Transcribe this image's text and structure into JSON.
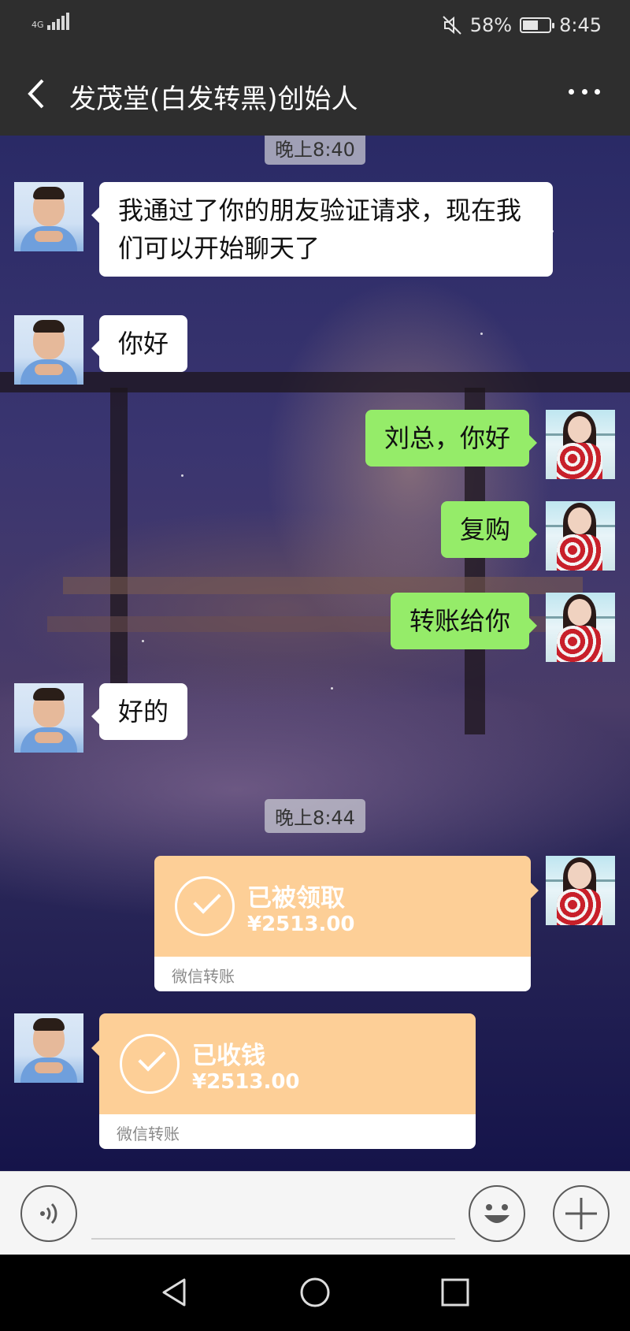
{
  "status_bar": {
    "network": "4G",
    "battery_percent": "58%",
    "battery_level": 0.58,
    "time": "8:45",
    "mute_icon": "mute-icon",
    "battery_icon": "battery-icon",
    "signal_icon": "signal-icon"
  },
  "header": {
    "title": "发茂堂(白发转黑)创始人",
    "back_icon": "chevron-left-icon",
    "more_icon": "more-horizontal-icon"
  },
  "messages": {
    "ts1": "晚上8:40",
    "m1": "我通过了你的朋友验证请求，现在我们可以开始聊天了",
    "m2": "你好",
    "m3": "刘总，你好",
    "m4": "复购",
    "m5": "转账给你",
    "m6": "好的",
    "ts2": "晚上8:44",
    "tr1": {
      "status": "已被领取",
      "amount": "¥2513.00",
      "label": "微信转账"
    },
    "tr2": {
      "status": "已收钱",
      "amount": "¥2513.00",
      "label": "微信转账"
    }
  },
  "input_bar": {
    "voice_icon": "voice-icon",
    "emoji_icon": "emoji-icon",
    "plus_icon": "plus-icon",
    "placeholder": ""
  },
  "nav_bar": {
    "back_icon": "triangle-back-icon",
    "home_icon": "circle-home-icon",
    "recents_icon": "square-recents-icon"
  },
  "colors": {
    "header_bg": "#2e2e2e",
    "incoming_bubble": "#ffffff",
    "outgoing_bubble": "#95ec69",
    "transfer_bg": "#fdcf97"
  }
}
